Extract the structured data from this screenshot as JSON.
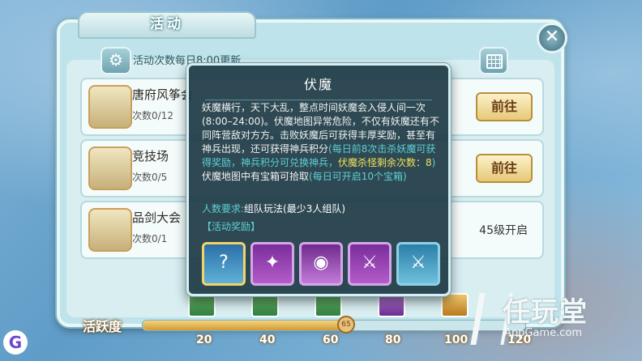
{
  "window": {
    "title": "活动"
  },
  "header": {
    "refresh_text": "活动次数每日8:00更新"
  },
  "activities": [
    {
      "name": "唐府风筝会",
      "count": "次数0/12",
      "action": "前往"
    },
    {
      "name": "竞技场",
      "count": "次数0/5",
      "action": "前往"
    },
    {
      "name": "品剑大会",
      "count": "次数0/1",
      "action": "45级开启"
    }
  ],
  "activity_bar": {
    "label": "活跃度",
    "value": 65,
    "max": 120,
    "ticks": [
      "20",
      "40",
      "60",
      "80",
      "100",
      "120"
    ]
  },
  "dialog": {
    "title": "伏魔",
    "desc_1": "妖魔横行，天下大乱，整点时间妖魔会入侵人间一次(8:00–24:00)。伏魔地图异常危险，不仅有妖魔还有不同阵营敌对方方。击败妖魔后可获得丰厚奖励，甚至有神兵出现，还可获得神兵积分",
    "desc_hl": "(每日前8次击杀妖魔可获得奖励，神兵积分可兑换神兵，",
    "desc_yl": "伏魔杀怪剩余次数：8",
    "desc_hl_end": ")",
    "desc_2": "伏魔地图中有宝箱可拾取",
    "desc_2_hl": "(每日可开启10个宝箱)",
    "requirement_label": "人数要求:",
    "requirement_value": "组队玩法(最少3人组队)",
    "reward_header": "【活动奖励】",
    "rewards": [
      {
        "icon": "mystery-weapon-icon",
        "glyph": "?"
      },
      {
        "icon": "purple-pouch-icon",
        "glyph": "✦"
      },
      {
        "icon": "gold-orb-icon",
        "glyph": "◉"
      },
      {
        "icon": "weapon-card-icon",
        "glyph": "⚔"
      },
      {
        "icon": "sword-card-icon",
        "glyph": "⚔"
      }
    ]
  },
  "watermark": {
    "main": "任玩堂",
    "sub": "AppGame.com"
  },
  "colors": {
    "accent": "#5ecfd4",
    "highlight": "#f1e15a",
    "dialog_bg": "#1c3a44"
  }
}
